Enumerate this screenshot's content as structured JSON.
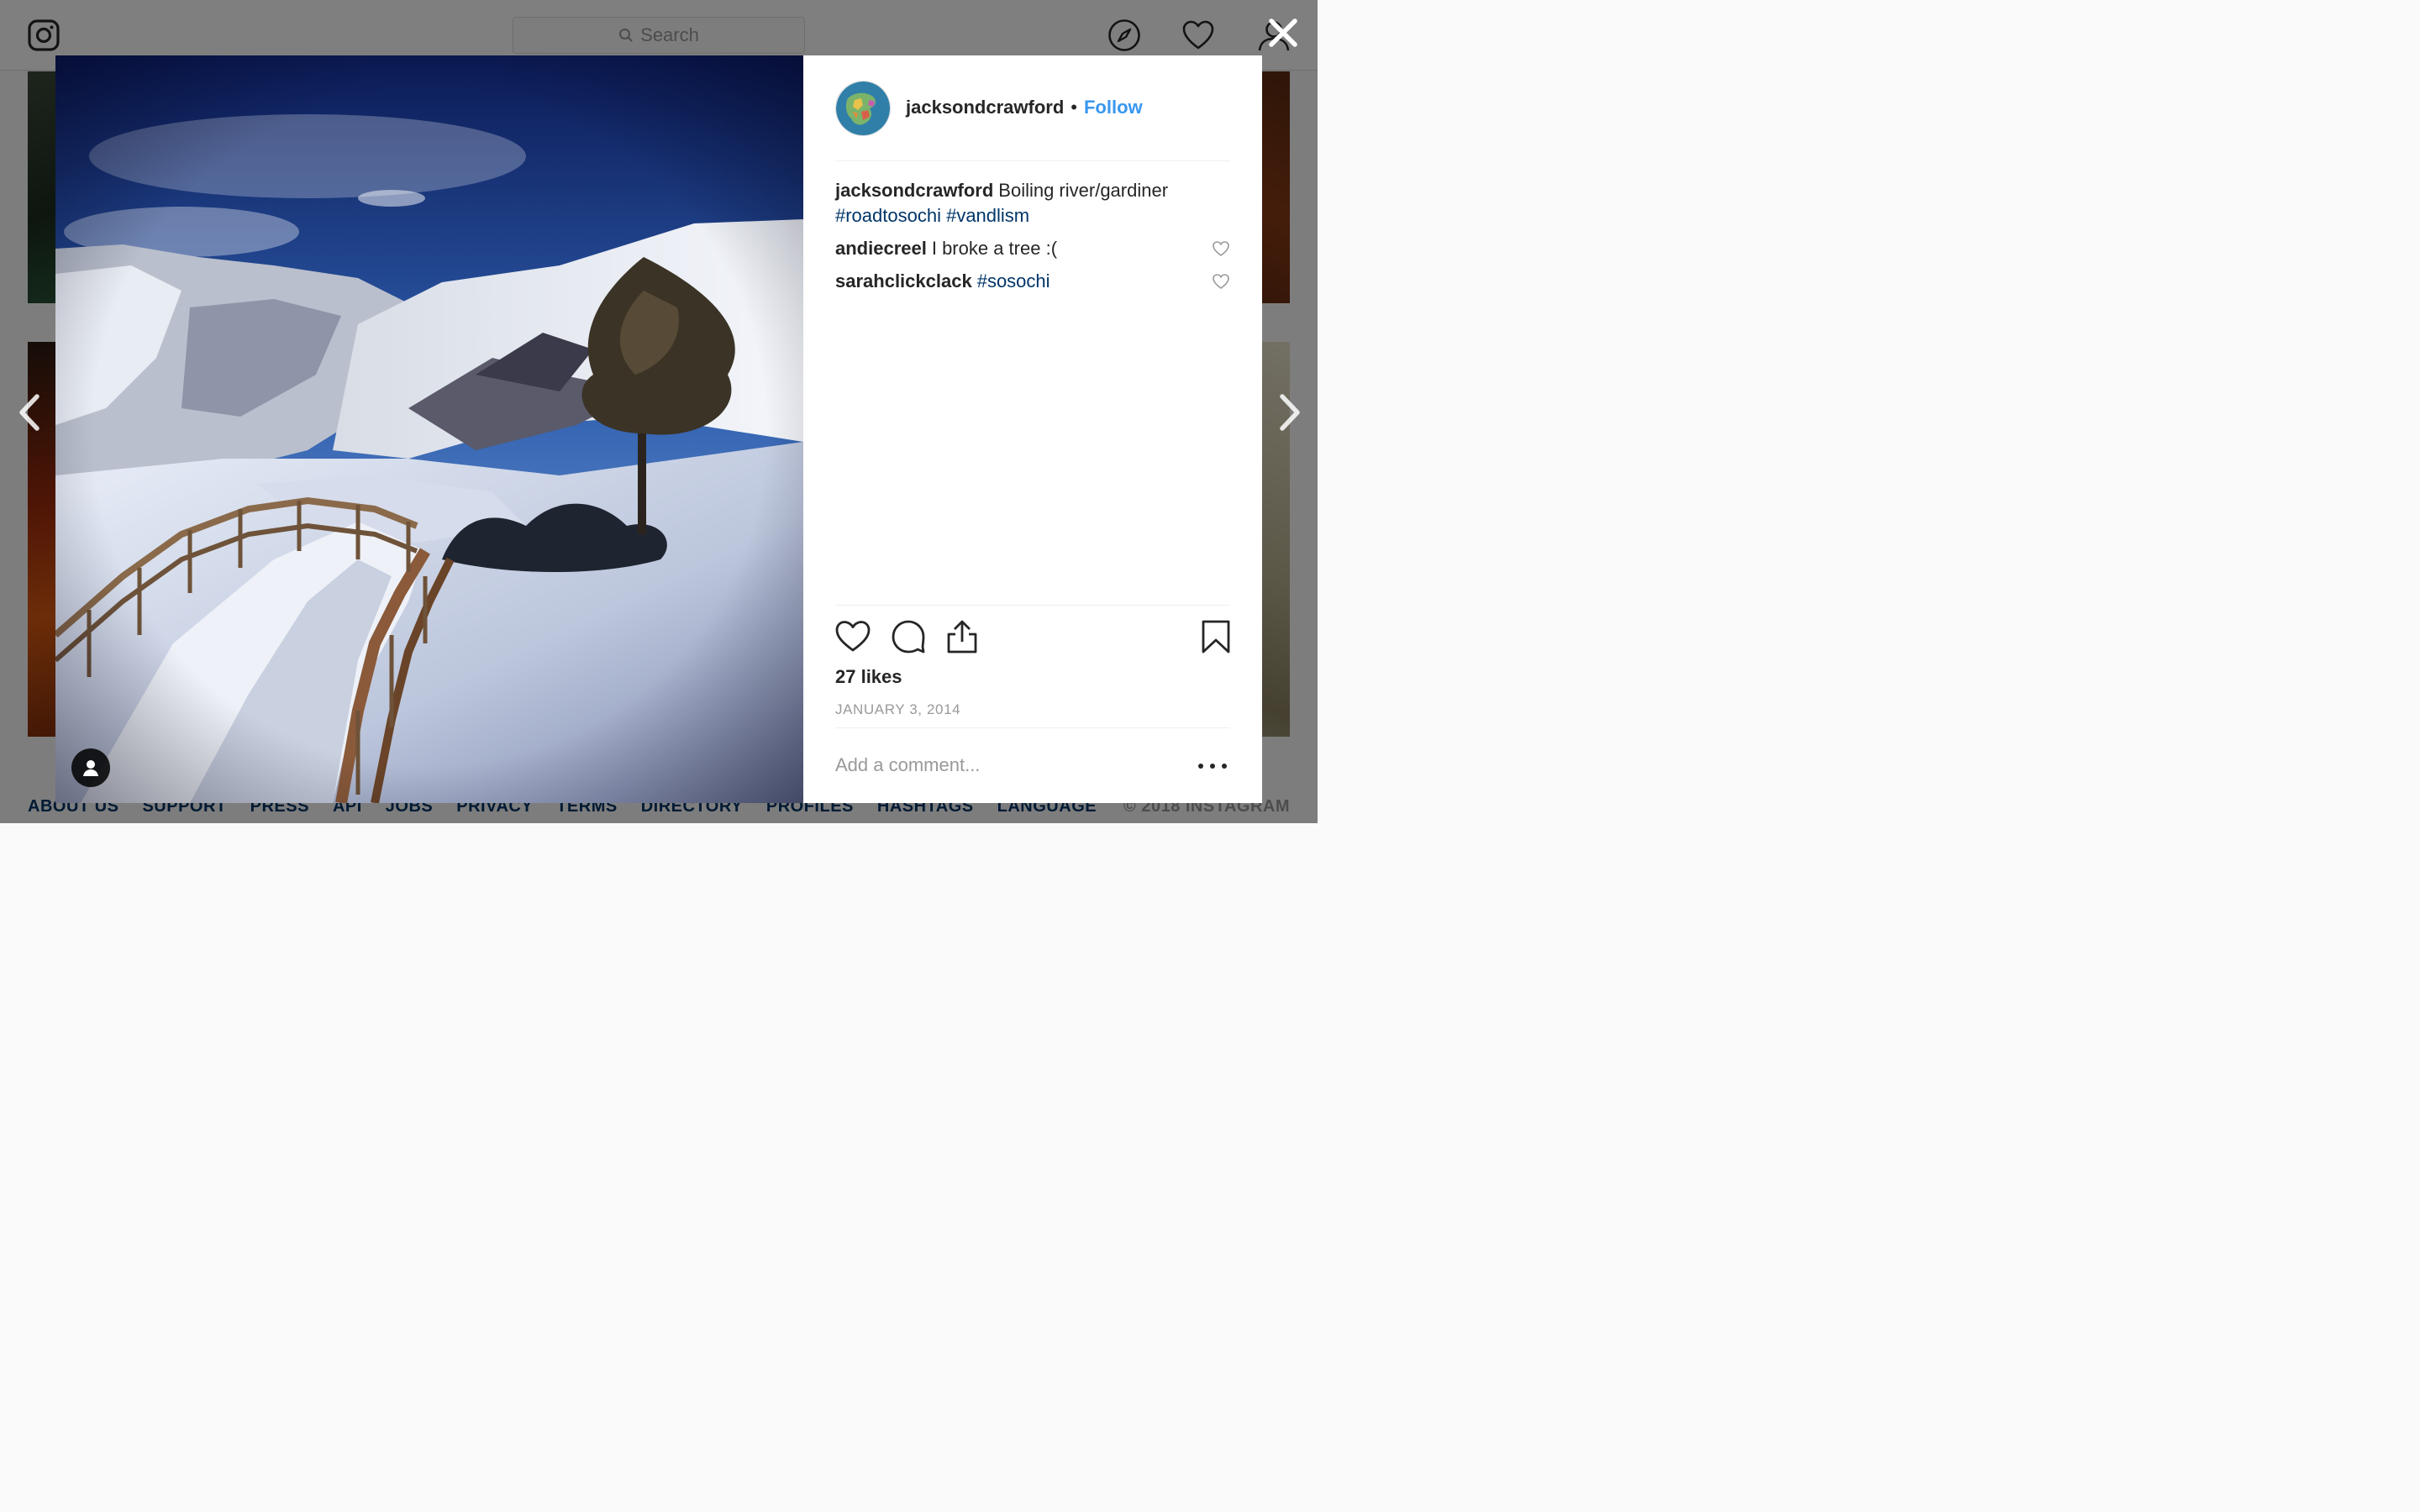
{
  "topbar": {
    "search_placeholder": "Search"
  },
  "footer": {
    "links": [
      "ABOUT US",
      "SUPPORT",
      "PRESS",
      "API",
      "JOBS",
      "PRIVACY",
      "TERMS",
      "DIRECTORY",
      "PROFILES",
      "HASHTAGS",
      "LANGUAGE"
    ],
    "copyright": "© 2018 INSTAGRAM"
  },
  "post": {
    "author": "jacksondcrawford",
    "separator": "•",
    "follow_label": "Follow",
    "caption": {
      "user": "jacksondcrawford",
      "text": "Boiling river/gardiner",
      "hashtags": "#roadtosochi #vandlism"
    },
    "comments": [
      {
        "user": "andiecreel",
        "text": "I broke a tree :("
      },
      {
        "user": "sarahclickclack",
        "text": "#sosochi"
      }
    ],
    "likes": "27 likes",
    "date": "JANUARY 3, 2014",
    "comment_placeholder": "Add a comment..."
  },
  "icons": {
    "logo": "instagram-logo-icon",
    "explore": "compass-icon",
    "activity": "heart-icon",
    "profile": "user-icon",
    "close": "close-icon",
    "prev": "chevron-left-icon",
    "next": "chevron-right-icon",
    "like": "heart-outline-icon",
    "comment": "speech-bubble-icon",
    "share": "share-icon",
    "save": "bookmark-icon",
    "more": "more-dots-icon",
    "tagged_user": "person-icon"
  },
  "colors": {
    "link_blue": "#3897f0",
    "hashtag_blue": "#003569",
    "muted_gray": "#999999",
    "text": "#262626"
  }
}
